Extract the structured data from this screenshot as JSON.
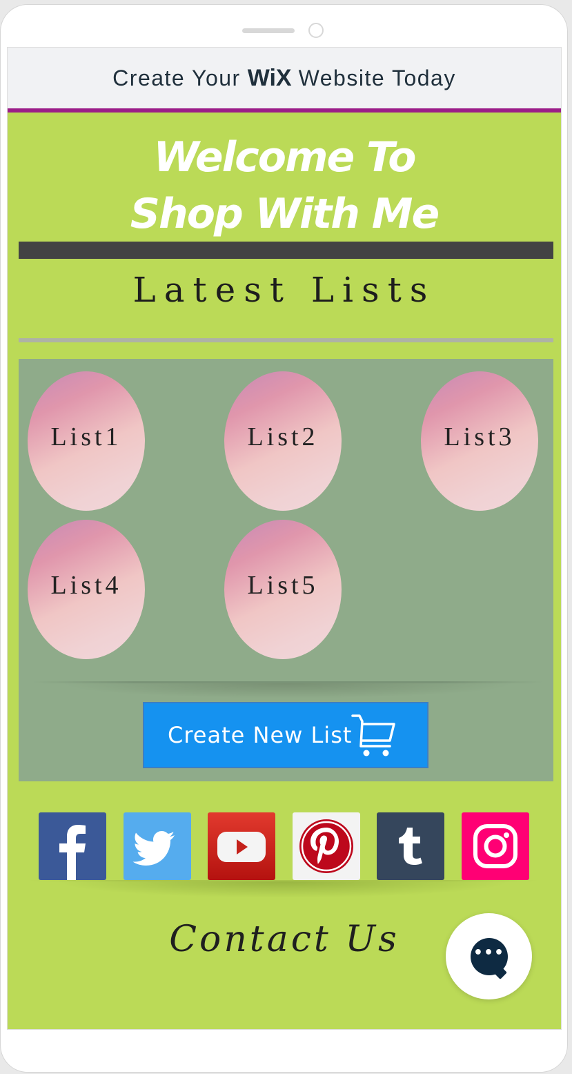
{
  "banner": {
    "pre": "Create Your",
    "brand": "WiX",
    "post": "Website Today"
  },
  "hero": {
    "line1": "Welcome To",
    "line2": "Shop With Me"
  },
  "section_title": "Latest Lists",
  "lists": [
    {
      "label": "List1"
    },
    {
      "label": "List2"
    },
    {
      "label": "List3"
    },
    {
      "label": "List4"
    },
    {
      "label": "List5"
    }
  ],
  "create_button": {
    "label": "Create New List",
    "icon": "shopping-cart-icon"
  },
  "socials": [
    {
      "name": "facebook",
      "icon": "facebook-icon",
      "color": "#3b5998"
    },
    {
      "name": "twitter",
      "icon": "twitter-icon",
      "color": "#55acee"
    },
    {
      "name": "youtube",
      "icon": "youtube-icon",
      "color": "#cc1f1f"
    },
    {
      "name": "pinterest",
      "icon": "pinterest-icon",
      "color": "#bd081c"
    },
    {
      "name": "tumblr",
      "icon": "tumblr-icon",
      "color": "#35465c"
    },
    {
      "name": "instagram",
      "icon": "instagram-icon",
      "color": "#ff0074"
    }
  ],
  "contact_title": "Contact Us",
  "chat": {
    "icon": "chat-icon",
    "dots": "•••"
  },
  "colors": {
    "page_bg": "#bbda57",
    "banner_border": "#9b1d88",
    "panel_bg": "#8fab8a",
    "button_bg": "#1592f0",
    "chat_bg": "#0e2a42"
  }
}
